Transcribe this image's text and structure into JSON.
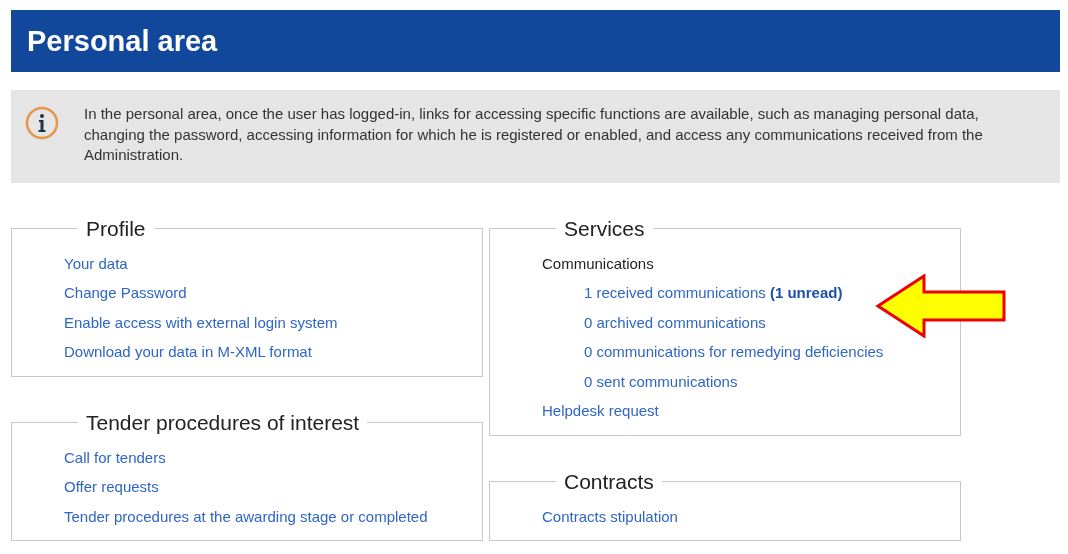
{
  "header": {
    "title": "Personal area"
  },
  "info": {
    "text": "In the personal area, once the user has logged-in, links for accessing specific functions are available, such as managing personal data, changing the password, accessing information for which he is registered or enabled, and access any communications received from the Administration."
  },
  "columns": [
    {
      "sections": [
        {
          "title": "Profile",
          "items": [
            {
              "kind": "link",
              "label": "Your data"
            },
            {
              "kind": "link",
              "label": "Change Password"
            },
            {
              "kind": "link",
              "label": "Enable access with external login system"
            },
            {
              "kind": "link",
              "label": "Download your data in M-XML format"
            }
          ]
        },
        {
          "title": "Tender procedures of interest",
          "items": [
            {
              "kind": "link",
              "label": "Call for tenders"
            },
            {
              "kind": "link",
              "label": "Offer requests"
            },
            {
              "kind": "link",
              "label": "Tender procedures at the awarding stage or completed"
            }
          ]
        }
      ]
    },
    {
      "sections": [
        {
          "title": "Services",
          "items": [
            {
              "kind": "heading",
              "label": "Communications",
              "children": [
                {
                  "kind": "link",
                  "label": "1 received communications **(1 unread)**",
                  "highlighted": true
                },
                {
                  "kind": "link",
                  "label": "0 archived communications",
                  "highlighted": false
                },
                {
                  "kind": "link",
                  "label": "0 communications for remedying deficiencies",
                  "highlighted": false
                },
                {
                  "kind": "link",
                  "label": "0 sent communications",
                  "highlighted": false
                }
              ]
            },
            {
              "kind": "link",
              "label": "Helpdesk request"
            }
          ]
        },
        {
          "title": "Contracts",
          "items": [
            {
              "kind": "link",
              "label": "Contracts stipulation"
            }
          ]
        }
      ]
    }
  ]
}
